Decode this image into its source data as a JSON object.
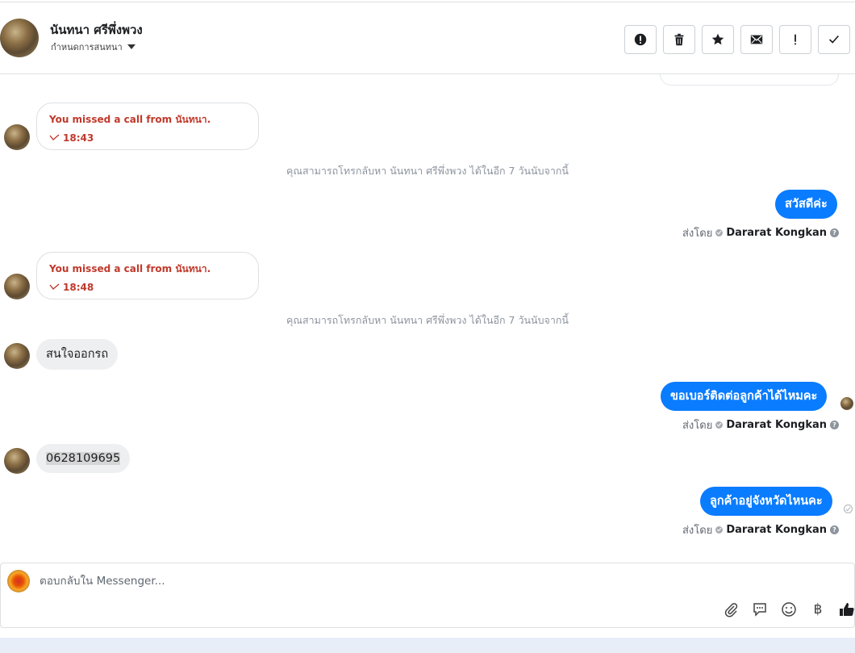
{
  "header": {
    "contact_name": "นันทนา ศรีพึ่งพวง",
    "subtitle": "กำหนดการสนทนา",
    "actions": [
      {
        "name": "report-button",
        "icon": "exclamation-circle-icon"
      },
      {
        "name": "delete-button",
        "icon": "trash-icon"
      },
      {
        "name": "star-button",
        "icon": "star-icon"
      },
      {
        "name": "mark-unread-button",
        "icon": "envelope-icon"
      },
      {
        "name": "mark-spam-button",
        "icon": "exclamation-icon"
      },
      {
        "name": "mark-done-button",
        "icon": "check-icon"
      }
    ]
  },
  "messages": {
    "call1": {
      "title": "You missed a call from นันทนา.",
      "time": "18:43"
    },
    "note1": "คุณสามารถโทรกลับหา นันทนา ศรีพึ่งพวง ได้ในอีก 7 วันนับจากนี้",
    "out1": "สวัสดีค่ะ",
    "sent_by_label": "ส่งโดย",
    "sender": "Dararat Kongkan",
    "call2": {
      "title": "You missed a call from นันทนา.",
      "time": "18:48"
    },
    "note2": "คุณสามารถโทรกลับหา นันทนา ศรีพึ่งพวง ได้ในอีก 7 วันนับจากนี้",
    "in1": "สนใจออกรถ",
    "out2": "ขอเบอร์ติดต่อลูกค้าได้ไหมคะ",
    "in2": "0628109695",
    "out3": "ลูกค้าอยู่จังหวัดไหนคะ"
  },
  "composer": {
    "placeholder": "ตอบกลับใน Messenger...",
    "tools": [
      "paperclip-icon",
      "saved-replies-icon",
      "emoji-icon",
      "baht-icon",
      "like-icon"
    ],
    "baht_symbol": "฿"
  },
  "colors": {
    "outgoing": "#0a7cff",
    "incoming": "#eeeff1",
    "missed_call": "#c0392b"
  }
}
